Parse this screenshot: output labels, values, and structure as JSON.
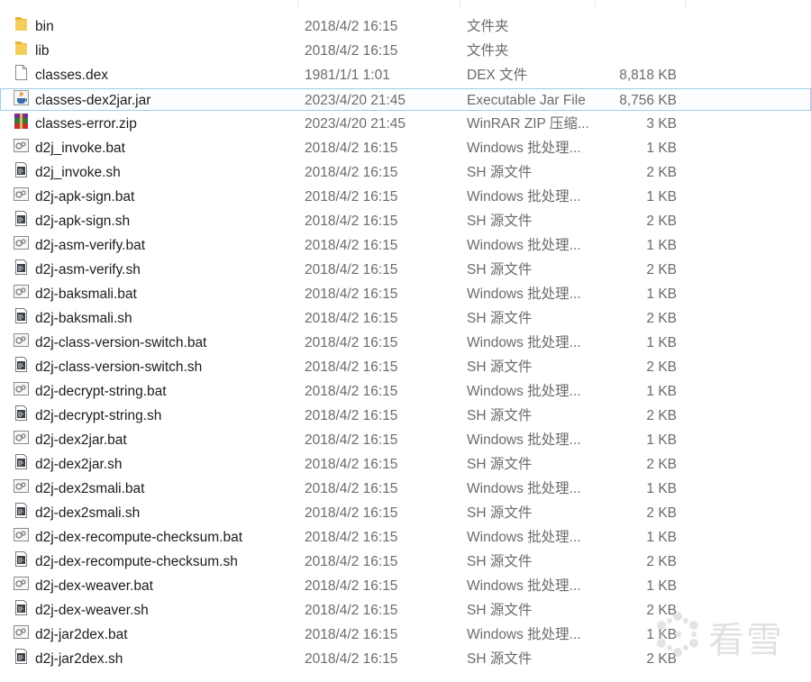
{
  "files": [
    {
      "name": "bin",
      "date": "2018/4/2 16:15",
      "type": "文件夹",
      "size": "",
      "icon": "folder-icon"
    },
    {
      "name": "lib",
      "date": "2018/4/2 16:15",
      "type": "文件夹",
      "size": "",
      "icon": "folder-icon"
    },
    {
      "name": "classes.dex",
      "date": "1981/1/1 1:01",
      "type": "DEX 文件",
      "size": "8,818 KB",
      "icon": "blank-file-icon"
    },
    {
      "name": "classes-dex2jar.jar",
      "date": "2023/4/20 21:45",
      "type": "Executable Jar File",
      "size": "8,756 KB",
      "icon": "java-jar-icon",
      "selected": true
    },
    {
      "name": "classes-error.zip",
      "date": "2023/4/20 21:45",
      "type": "WinRAR ZIP 压缩...",
      "size": "3 KB",
      "icon": "winrar-archive-icon"
    },
    {
      "name": "d2j_invoke.bat",
      "date": "2018/4/2 16:15",
      "type": "Windows 批处理...",
      "size": "1 KB",
      "icon": "batch-file-icon"
    },
    {
      "name": "d2j_invoke.sh",
      "date": "2018/4/2 16:15",
      "type": "SH 源文件",
      "size": "2 KB",
      "icon": "shell-script-icon"
    },
    {
      "name": "d2j-apk-sign.bat",
      "date": "2018/4/2 16:15",
      "type": "Windows 批处理...",
      "size": "1 KB",
      "icon": "batch-file-icon"
    },
    {
      "name": "d2j-apk-sign.sh",
      "date": "2018/4/2 16:15",
      "type": "SH 源文件",
      "size": "2 KB",
      "icon": "shell-script-icon"
    },
    {
      "name": "d2j-asm-verify.bat",
      "date": "2018/4/2 16:15",
      "type": "Windows 批处理...",
      "size": "1 KB",
      "icon": "batch-file-icon"
    },
    {
      "name": "d2j-asm-verify.sh",
      "date": "2018/4/2 16:15",
      "type": "SH 源文件",
      "size": "2 KB",
      "icon": "shell-script-icon"
    },
    {
      "name": "d2j-baksmali.bat",
      "date": "2018/4/2 16:15",
      "type": "Windows 批处理...",
      "size": "1 KB",
      "icon": "batch-file-icon"
    },
    {
      "name": "d2j-baksmali.sh",
      "date": "2018/4/2 16:15",
      "type": "SH 源文件",
      "size": "2 KB",
      "icon": "shell-script-icon"
    },
    {
      "name": "d2j-class-version-switch.bat",
      "date": "2018/4/2 16:15",
      "type": "Windows 批处理...",
      "size": "1 KB",
      "icon": "batch-file-icon"
    },
    {
      "name": "d2j-class-version-switch.sh",
      "date": "2018/4/2 16:15",
      "type": "SH 源文件",
      "size": "2 KB",
      "icon": "shell-script-icon"
    },
    {
      "name": "d2j-decrypt-string.bat",
      "date": "2018/4/2 16:15",
      "type": "Windows 批处理...",
      "size": "1 KB",
      "icon": "batch-file-icon"
    },
    {
      "name": "d2j-decrypt-string.sh",
      "date": "2018/4/2 16:15",
      "type": "SH 源文件",
      "size": "2 KB",
      "icon": "shell-script-icon"
    },
    {
      "name": "d2j-dex2jar.bat",
      "date": "2018/4/2 16:15",
      "type": "Windows 批处理...",
      "size": "1 KB",
      "icon": "batch-file-icon"
    },
    {
      "name": "d2j-dex2jar.sh",
      "date": "2018/4/2 16:15",
      "type": "SH 源文件",
      "size": "2 KB",
      "icon": "shell-script-icon"
    },
    {
      "name": "d2j-dex2smali.bat",
      "date": "2018/4/2 16:15",
      "type": "Windows 批处理...",
      "size": "1 KB",
      "icon": "batch-file-icon"
    },
    {
      "name": "d2j-dex2smali.sh",
      "date": "2018/4/2 16:15",
      "type": "SH 源文件",
      "size": "2 KB",
      "icon": "shell-script-icon"
    },
    {
      "name": "d2j-dex-recompute-checksum.bat",
      "date": "2018/4/2 16:15",
      "type": "Windows 批处理...",
      "size": "1 KB",
      "icon": "batch-file-icon"
    },
    {
      "name": "d2j-dex-recompute-checksum.sh",
      "date": "2018/4/2 16:15",
      "type": "SH 源文件",
      "size": "2 KB",
      "icon": "shell-script-icon"
    },
    {
      "name": "d2j-dex-weaver.bat",
      "date": "2018/4/2 16:15",
      "type": "Windows 批处理...",
      "size": "1 KB",
      "icon": "batch-file-icon"
    },
    {
      "name": "d2j-dex-weaver.sh",
      "date": "2018/4/2 16:15",
      "type": "SH 源文件",
      "size": "2 KB",
      "icon": "shell-script-icon"
    },
    {
      "name": "d2j-jar2dex.bat",
      "date": "2018/4/2 16:15",
      "type": "Windows 批处理...",
      "size": "1 KB",
      "icon": "batch-file-icon"
    },
    {
      "name": "d2j-jar2dex.sh",
      "date": "2018/4/2 16:15",
      "type": "SH 源文件",
      "size": "2 KB",
      "icon": "shell-script-icon"
    }
  ],
  "watermark": {
    "text": "看雪",
    "icon": "snowflake-logo"
  },
  "colors": {
    "selection_border": "#9ecdea",
    "selection_fill": "#fbfdff",
    "folder": "#f0c94a"
  }
}
